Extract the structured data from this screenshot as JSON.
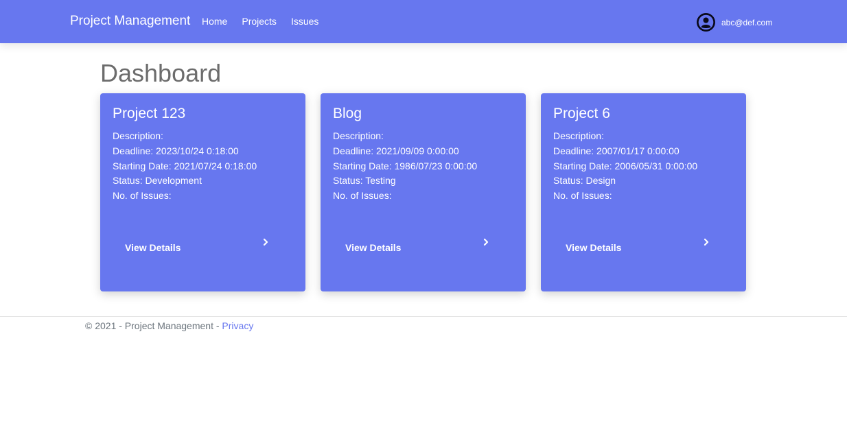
{
  "navbar": {
    "brand": "Project Management",
    "links": [
      {
        "label": "Home"
      },
      {
        "label": "Projects"
      },
      {
        "label": "Issues"
      }
    ],
    "user_email": "abc@def.com",
    "user_icon": "user-circle-icon"
  },
  "page": {
    "title": "Dashboard"
  },
  "projects": [
    {
      "name": "Project 123",
      "description": "Description:",
      "deadline": "Deadline: 2023/10/24 0:18:00",
      "starting_date": "Starting Date: 2021/07/24 0:18:00",
      "status": "Status: Development",
      "issues": "No. of Issues:",
      "button_label": "View Details"
    },
    {
      "name": "Blog",
      "description": "Description:",
      "deadline": "Deadline: 2021/09/09 0:00:00",
      "starting_date": "Starting Date: 1986/07/23 0:00:00",
      "status": "Status: Testing",
      "issues": "No. of Issues:",
      "button_label": "View Details"
    },
    {
      "name": "Project 6",
      "description": "Description:",
      "deadline": "Deadline: 2007/01/17 0:00:00",
      "starting_date": "Starting Date: 2006/05/31 0:00:00",
      "status": "Status: Design",
      "issues": "No. of Issues:",
      "button_label": "View Details"
    }
  ],
  "footer": {
    "text": "© 2021 - Project Management - ",
    "privacy_label": "Privacy"
  },
  "colors": {
    "primary": "#6777ef",
    "title": "#6c6c6c",
    "footer_text": "#6c757d"
  }
}
